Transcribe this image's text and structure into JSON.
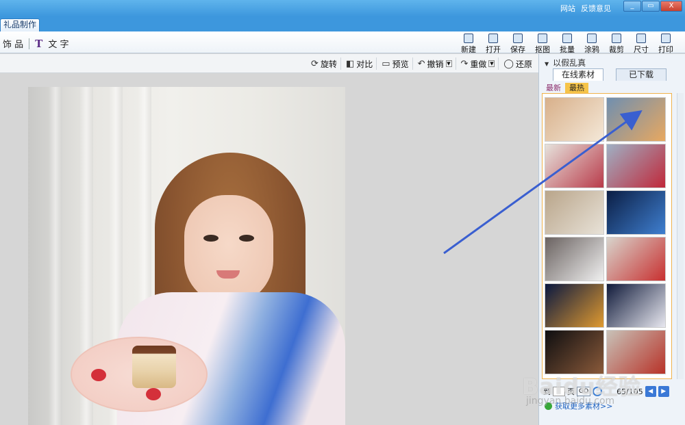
{
  "titlebar": {
    "links": [
      "网站",
      "反馈意见"
    ],
    "buttons": [
      "_",
      "▭",
      "X"
    ]
  },
  "tabstrip": {
    "active_tab": "礼品制作"
  },
  "toolbar": {
    "left": {
      "accessories_label": "饰 品",
      "text_icon": "T",
      "text_label": "文 字"
    },
    "tools": [
      {
        "label": "新建",
        "icon": "new-file-icon"
      },
      {
        "label": "打开",
        "icon": "folder-icon"
      },
      {
        "label": "保存",
        "icon": "save-icon"
      },
      {
        "label": "抠图",
        "icon": "cutout-icon"
      },
      {
        "label": "批量",
        "icon": "batch-icon"
      },
      {
        "label": "涂鸦",
        "icon": "doodle-icon"
      },
      {
        "label": "裁剪",
        "icon": "crop-icon"
      },
      {
        "label": "尺寸",
        "icon": "resize-icon"
      },
      {
        "label": "打印",
        "icon": "printer-icon"
      }
    ]
  },
  "subtoolbar": {
    "rotate": "旋转",
    "compare": "对比",
    "preview": "预览",
    "undo": "撤销",
    "redo": "重做",
    "restore": "还原"
  },
  "right_panel": {
    "header": "以假乱真",
    "tabs": [
      "在线素材",
      "已下载"
    ],
    "subtabs": [
      "最新",
      "最热"
    ],
    "thumbnails": [
      {
        "colors": [
          "#d8b08a",
          "#f4e8d8"
        ]
      },
      {
        "colors": [
          "#6f8fb0",
          "#e8a860"
        ]
      },
      {
        "colors": [
          "#e6e2dc",
          "#b93b4a"
        ]
      },
      {
        "colors": [
          "#9fb0c4",
          "#c0283a"
        ]
      },
      {
        "colors": [
          "#b9a58a",
          "#e8e2d8"
        ]
      },
      {
        "colors": [
          "#0b1e44",
          "#3f7fd0"
        ]
      },
      {
        "colors": [
          "#6a6260",
          "#f0f0f0"
        ]
      },
      {
        "colors": [
          "#d8d4cc",
          "#c83030"
        ]
      },
      {
        "colors": [
          "#0a1840",
          "#e09a30"
        ]
      },
      {
        "colors": [
          "#101a3a",
          "#e8e8f0"
        ]
      },
      {
        "colors": [
          "#0e0e10",
          "#8a5a3a"
        ]
      },
      {
        "colors": [
          "#c8c2b8",
          "#b83228"
        ]
      }
    ],
    "pager": {
      "prefix": "到",
      "page_word": "页",
      "go": "GO",
      "page_info": "65/105"
    },
    "more_link": "获取更多素材>>"
  },
  "watermark": {
    "main": "Baidu经验",
    "sub": "jingyan.baidu.com"
  },
  "colors": {
    "titlebar": "#3d97dd",
    "accent": "#f6c44a",
    "arrow": "#3a5fd0"
  }
}
